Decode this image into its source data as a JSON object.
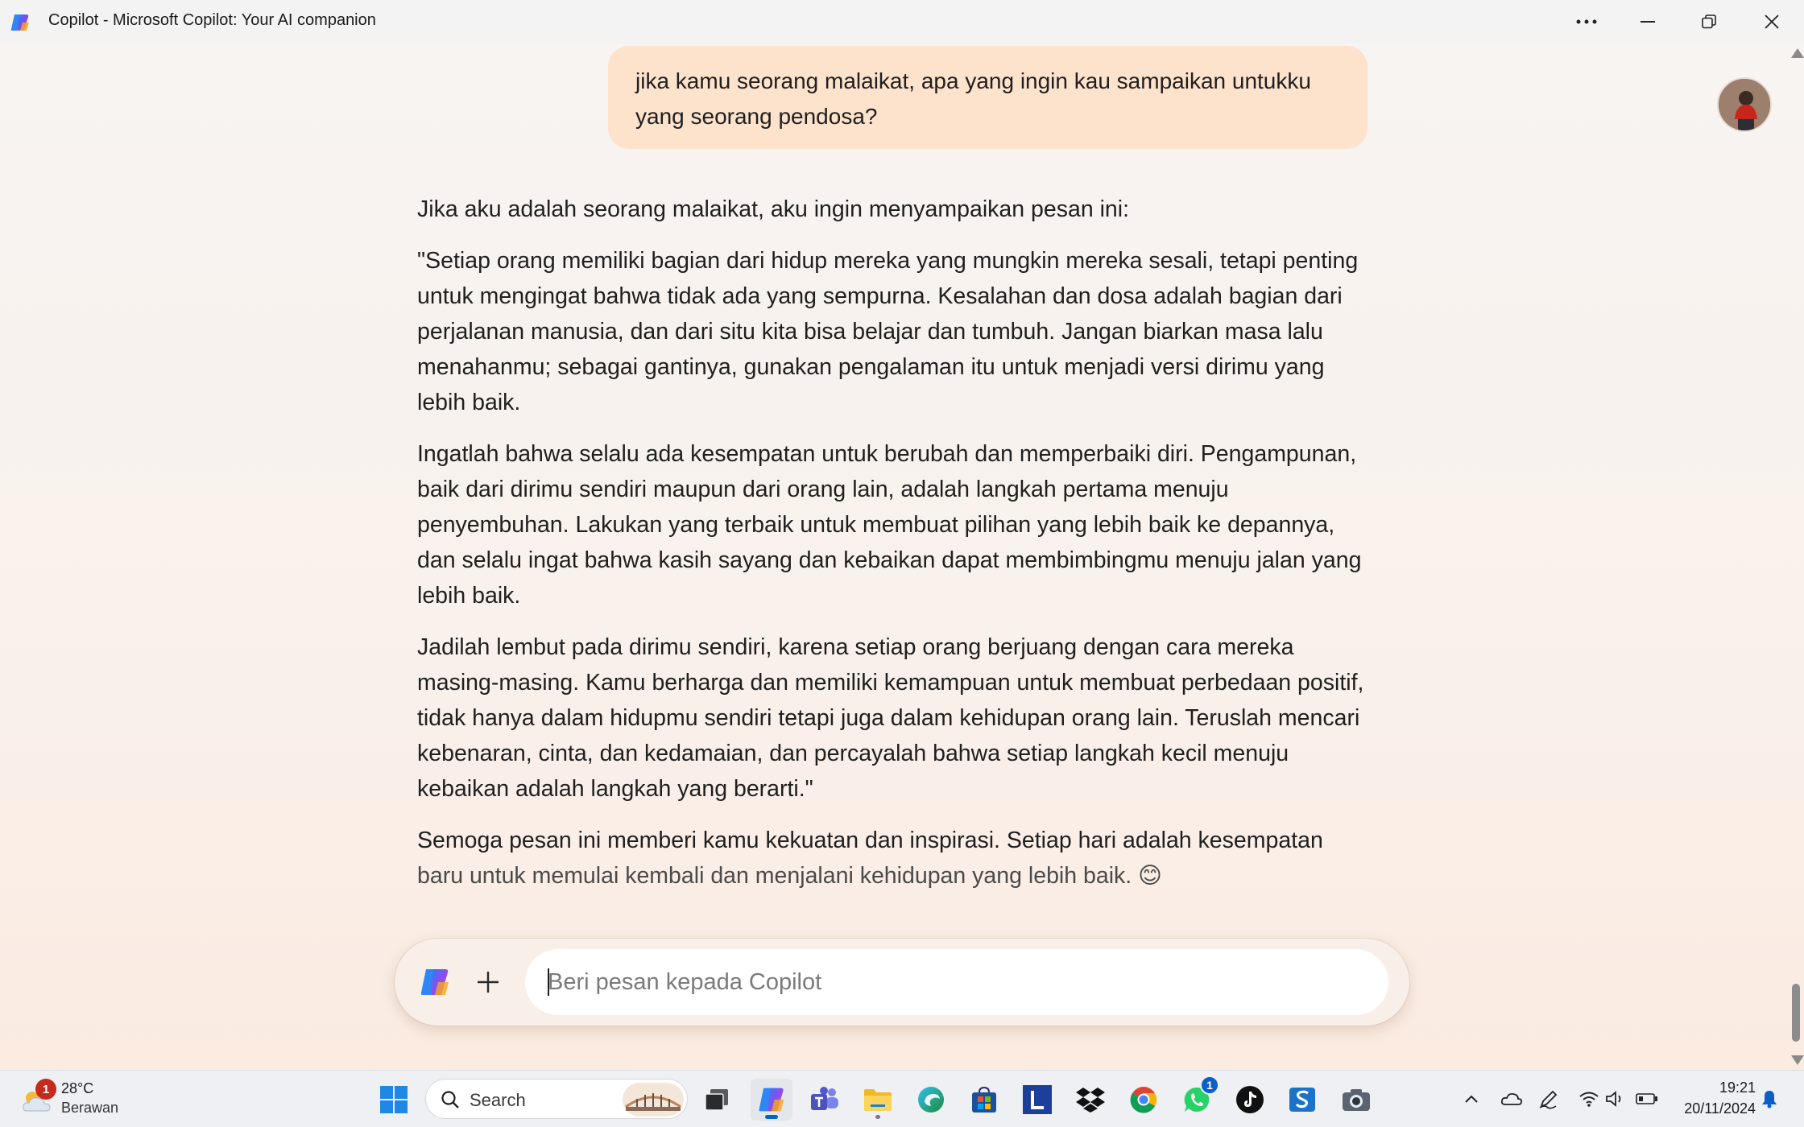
{
  "window": {
    "title": "Copilot - Microsoft Copilot: Your AI companion",
    "icons": [
      "copilot-logo-icon",
      "more-options-icon",
      "minimize-icon",
      "restore-icon",
      "close-icon"
    ]
  },
  "chat": {
    "user_message": "jika kamu seorang malaikat, apa yang ingin kau sampaikan untukku yang seorang pendosa?",
    "response_paragraphs": [
      "Jika aku adalah seorang malaikat, aku ingin menyampaikan pesan ini:",
      "\"Setiap orang memiliki bagian dari hidup mereka yang mungkin mereka sesali, tetapi penting untuk mengingat bahwa tidak ada yang sempurna. Kesalahan dan dosa adalah bagian dari perjalanan manusia, dan dari situ kita bisa belajar dan tumbuh. Jangan biarkan masa lalu menahanmu; sebagai gantinya, gunakan pengalaman itu untuk menjadi versi dirimu yang lebih baik.",
      "Ingatlah bahwa selalu ada kesempatan untuk berubah dan memperbaiki diri. Pengampunan, baik dari dirimu sendiri maupun dari orang lain, adalah langkah pertama menuju penyembuhan. Lakukan yang terbaik untuk membuat pilihan yang lebih baik ke depannya, dan selalu ingat bahwa kasih sayang dan kebaikan dapat membimbingmu menuju jalan yang lebih baik.",
      "Jadilah lembut pada dirimu sendiri, karena setiap orang berjuang dengan cara mereka masing-masing. Kamu berharga dan memiliki kemampuan untuk membuat perbedaan positif, tidak hanya dalam hidupmu sendiri tetapi juga dalam kehidupan orang lain. Teruslah mencari kebenaran, cinta, dan kedamaian, dan percayalah bahwa setiap langkah kecil menuju kebaikan adalah langkah yang berarti.\"",
      "Semoga pesan ini memberi kamu kekuatan dan inspirasi. Setiap hari adalah kesempatan",
      "baru untuk memulai kembali dan menjalani kehidupan yang lebih baik. 😊"
    ]
  },
  "composer": {
    "placeholder": "Beri pesan kepada Copilot",
    "value": ""
  },
  "taskbar": {
    "weather": {
      "badge": "1",
      "temp": "28°C",
      "condition": "Berawan"
    },
    "search_label": "Search",
    "apps": [
      "windows-start-icon",
      "search-icon",
      "task-view-icon",
      "copilot-icon",
      "teams-icon",
      "file-explorer-icon",
      "edge-icon",
      "store-icon",
      "l-app-icon",
      "dropbox-icon",
      "chrome-icon",
      "whatsapp-icon",
      "tiktok-icon",
      "s-app-icon",
      "camera-icon"
    ],
    "teams_badge": "",
    "whatsapp_badge": "1",
    "clock": {
      "time": "19:21",
      "date": "20/11/2024"
    }
  },
  "colors": {
    "user_bubble": "#fde2cc",
    "accent": "#0067c0",
    "badge_red": "#c42b1c"
  }
}
